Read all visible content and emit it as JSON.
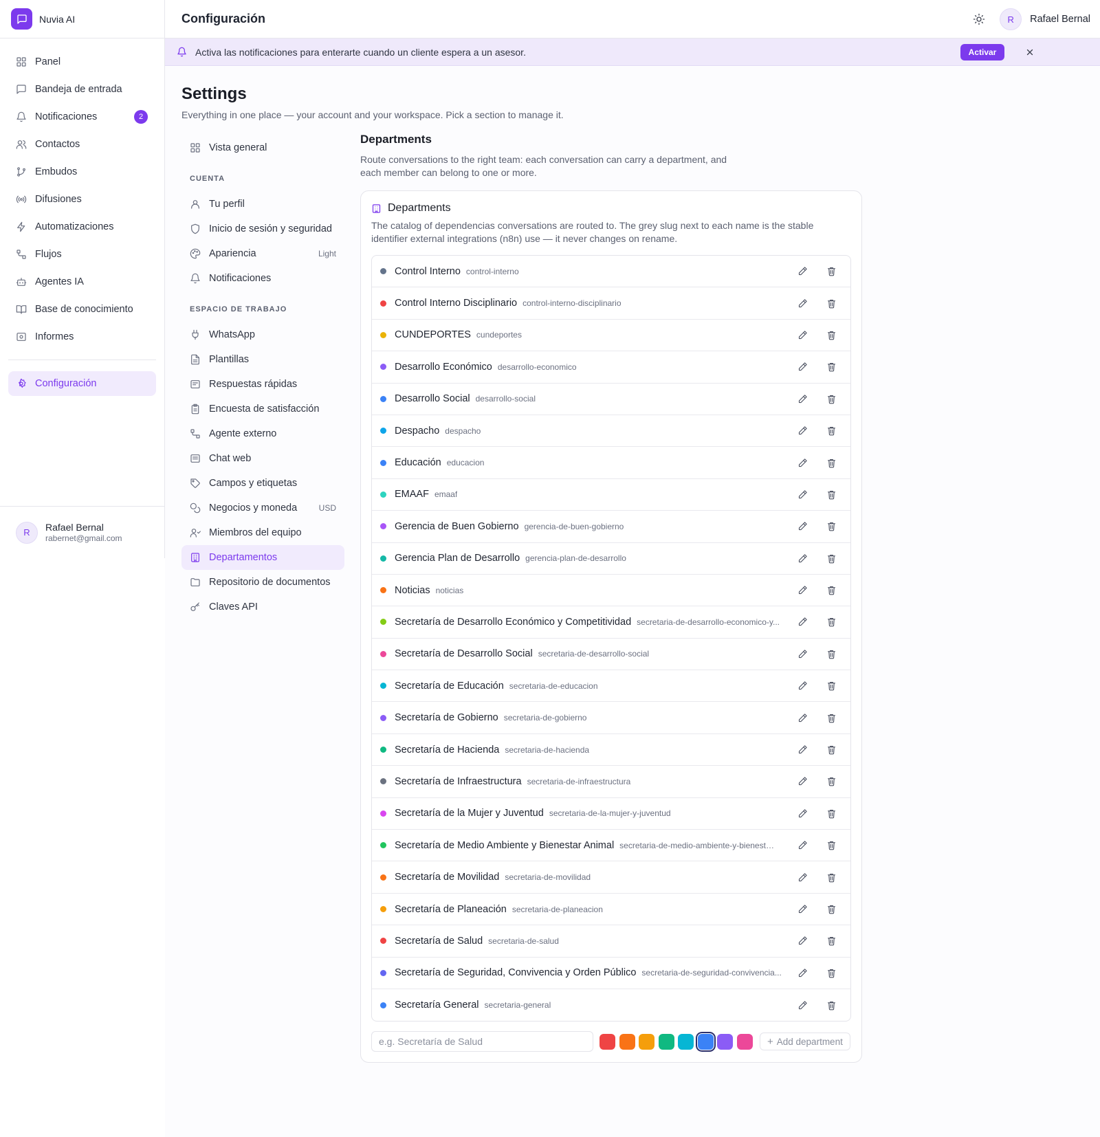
{
  "app": {
    "name": "Nuvia AI"
  },
  "sidebar": {
    "items": [
      {
        "label": "Panel",
        "icon": "grid-icon"
      },
      {
        "label": "Bandeja de entrada",
        "icon": "inbox-icon"
      },
      {
        "label": "Notificaciones",
        "icon": "bell-icon",
        "badge": "2"
      },
      {
        "label": "Contactos",
        "icon": "users-icon"
      },
      {
        "label": "Embudos",
        "icon": "git-branch-icon"
      },
      {
        "label": "Difusiones",
        "icon": "broadcast-icon"
      },
      {
        "label": "Automatizaciones",
        "icon": "bolt-icon"
      },
      {
        "label": "Flujos",
        "icon": "flow-icon"
      },
      {
        "label": "Agentes IA",
        "icon": "bot-icon"
      },
      {
        "label": "Base de conocimiento",
        "icon": "book-icon"
      },
      {
        "label": "Informes",
        "icon": "report-icon"
      }
    ],
    "active": {
      "label": "Configuración",
      "icon": "gear-icon"
    },
    "user": {
      "initial": "R",
      "name": "Rafael Bernal",
      "email": "rabernet@gmail.com"
    }
  },
  "header": {
    "title": "Configuración",
    "user": {
      "initial": "R",
      "name": "Rafael Bernal"
    }
  },
  "notice": {
    "text": "Activa las notificaciones para enterarte cuando un cliente espera a un asesor.",
    "button": "Activar"
  },
  "settings": {
    "title": "Settings",
    "subtitle": "Everything in one place — your account and your workspace. Pick a section to manage it.",
    "nav": {
      "overview": "Vista general",
      "account_label": "CUENTA",
      "account": [
        {
          "label": "Tu perfil",
          "icon": "user-icon"
        },
        {
          "label": "Inicio de sesión y seguridad",
          "icon": "shield-icon"
        },
        {
          "label": "Apariencia",
          "icon": "palette-icon",
          "meta": "Light"
        },
        {
          "label": "Notificaciones",
          "icon": "bell-icon"
        }
      ],
      "workspace_label": "ESPACIO DE TRABAJO",
      "workspace": [
        {
          "label": "WhatsApp",
          "icon": "plug-icon"
        },
        {
          "label": "Plantillas",
          "icon": "file-icon"
        },
        {
          "label": "Respuestas rápidas",
          "icon": "message-square-icon"
        },
        {
          "label": "Encuesta de satisfacción",
          "icon": "clipboard-icon"
        },
        {
          "label": "Agente externo",
          "icon": "workflow-icon"
        },
        {
          "label": "Chat web",
          "icon": "chat-icon"
        },
        {
          "label": "Campos y etiquetas",
          "icon": "tag-icon"
        },
        {
          "label": "Negocios y moneda",
          "icon": "coins-icon",
          "meta": "USD"
        },
        {
          "label": "Miembros del equipo",
          "icon": "team-icon"
        },
        {
          "label": "Departamentos",
          "icon": "building-icon",
          "active": true
        },
        {
          "label": "Repositorio de documentos",
          "icon": "folder-icon"
        },
        {
          "label": "Claves API",
          "icon": "key-icon"
        }
      ]
    }
  },
  "departments": {
    "heading": "Departments",
    "description": "Route conversations to the right team: each conversation can carry a department, and each member can belong to one or more.",
    "card_title": "Departments",
    "card_description": "The catalog of dependencias conversations are routed to. The grey slug next to each name is the stable identifier external integrations (n8n) use — it never changes on rename.",
    "items": [
      {
        "name": "Control Interno",
        "slug": "control-interno",
        "color": "#64748b"
      },
      {
        "name": "Control Interno Disciplinario",
        "slug": "control-interno-disciplinario",
        "color": "#ef4444"
      },
      {
        "name": "CUNDEPORTES",
        "slug": "cundeportes",
        "color": "#eab308"
      },
      {
        "name": "Desarrollo Económico",
        "slug": "desarrollo-economico",
        "color": "#8b5cf6"
      },
      {
        "name": "Desarrollo Social",
        "slug": "desarrollo-social",
        "color": "#3b82f6"
      },
      {
        "name": "Despacho",
        "slug": "despacho",
        "color": "#0ea5e9"
      },
      {
        "name": "Educación",
        "slug": "educacion",
        "color": "#3b82f6"
      },
      {
        "name": "EMAAF",
        "slug": "emaaf",
        "color": "#2dd4bf"
      },
      {
        "name": "Gerencia de Buen Gobierno",
        "slug": "gerencia-de-buen-gobierno",
        "color": "#a855f7"
      },
      {
        "name": "Gerencia Plan de Desarrollo",
        "slug": "gerencia-plan-de-desarrollo",
        "color": "#14b8a6"
      },
      {
        "name": "Noticias",
        "slug": "noticias",
        "color": "#f97316"
      },
      {
        "name": "Secretaría de Desarrollo Económico y Competitividad",
        "slug": "secretaria-de-desarrollo-economico-y...",
        "color": "#84cc16"
      },
      {
        "name": "Secretaría de Desarrollo Social",
        "slug": "secretaria-de-desarrollo-social",
        "color": "#ec4899"
      },
      {
        "name": "Secretaría de Educación",
        "slug": "secretaria-de-educacion",
        "color": "#06b6d4"
      },
      {
        "name": "Secretaría de Gobierno",
        "slug": "secretaria-de-gobierno",
        "color": "#8b5cf6"
      },
      {
        "name": "Secretaría de Hacienda",
        "slug": "secretaria-de-hacienda",
        "color": "#10b981"
      },
      {
        "name": "Secretaría de Infraestructura",
        "slug": "secretaria-de-infraestructura",
        "color": "#6b7280"
      },
      {
        "name": "Secretaría de la Mujer y Juventud",
        "slug": "secretaria-de-la-mujer-y-juventud",
        "color": "#d946ef"
      },
      {
        "name": "Secretaría de Medio Ambiente y Bienestar Animal",
        "slug": "secretaria-de-medio-ambiente-y-bienestar...",
        "color": "#22c55e"
      },
      {
        "name": "Secretaría de Movilidad",
        "slug": "secretaria-de-movilidad",
        "color": "#f97316"
      },
      {
        "name": "Secretaría de Planeación",
        "slug": "secretaria-de-planeacion",
        "color": "#f59e0b"
      },
      {
        "name": "Secretaría de Salud",
        "slug": "secretaria-de-salud",
        "color": "#ef4444"
      },
      {
        "name": "Secretaría de Seguridad, Convivencia y Orden Público",
        "slug": "secretaria-de-seguridad-convivencia...",
        "color": "#6366f1"
      },
      {
        "name": "Secretaría General",
        "slug": "secretaria-general",
        "color": "#3b82f6"
      }
    ],
    "new_placeholder": "e.g. Secretaría de Salud",
    "swatches": [
      "#ef4444",
      "#f97316",
      "#f59e0b",
      "#10b981",
      "#06b6d4",
      "#3b82f6",
      "#8b5cf6",
      "#ec4899"
    ],
    "selected_swatch": "#3b82f6",
    "add_label": "Add department"
  }
}
